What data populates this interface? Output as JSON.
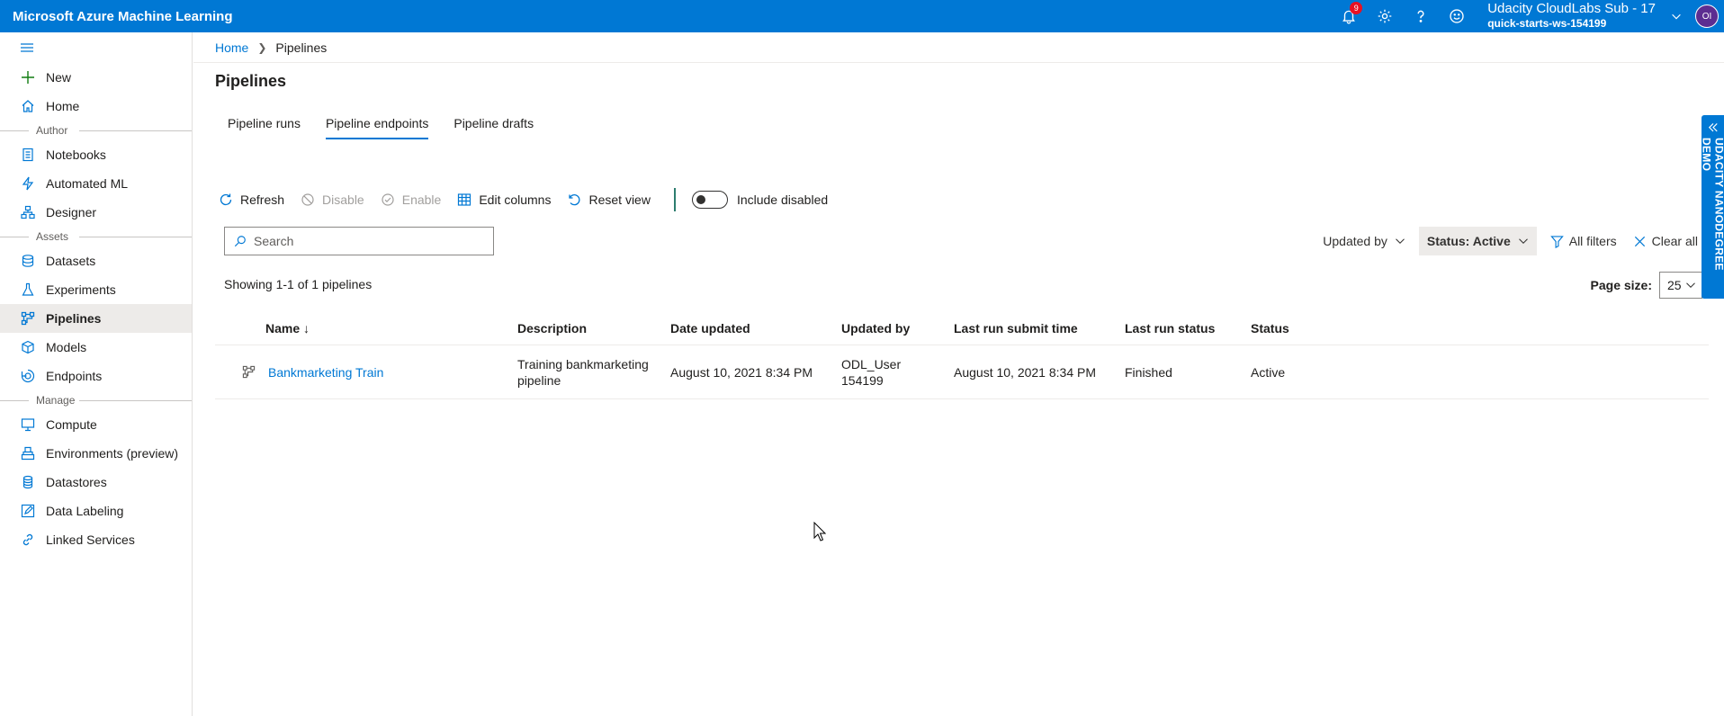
{
  "app": {
    "title": "Microsoft Azure Machine Learning",
    "notifications_count": "9",
    "account_line1": "Udacity CloudLabs Sub - 17",
    "account_line2": "quick-starts-ws-154199",
    "avatar_initials": "OI",
    "brand_color": "#0078d4"
  },
  "sidebar": {
    "new": "New",
    "home": "Home",
    "section_author": "Author",
    "notebooks": "Notebooks",
    "automated_ml": "Automated ML",
    "designer": "Designer",
    "section_assets": "Assets",
    "datasets": "Datasets",
    "experiments": "Experiments",
    "pipelines": "Pipelines",
    "models": "Models",
    "endpoints": "Endpoints",
    "section_manage": "Manage",
    "compute": "Compute",
    "environments": "Environments (preview)",
    "datastores": "Datastores",
    "data_labeling": "Data Labeling",
    "linked_services": "Linked Services"
  },
  "breadcrumb": {
    "home": "Home",
    "current": "Pipelines"
  },
  "page": {
    "title": "Pipelines"
  },
  "tabs": [
    "Pipeline runs",
    "Pipeline endpoints",
    "Pipeline drafts"
  ],
  "toolbar": {
    "refresh": "Refresh",
    "disable": "Disable",
    "enable": "Enable",
    "edit_columns": "Edit columns",
    "reset_view": "Reset view",
    "include_disabled": "Include disabled"
  },
  "search": {
    "placeholder": "Search"
  },
  "filters": {
    "updated_by": "Updated by",
    "status": "Status: Active",
    "all_filters": "All filters",
    "clear_all": "Clear all"
  },
  "list": {
    "showing": "Showing 1-1 of 1 pipelines",
    "page_size_label": "Page size:",
    "page_size_value": "25"
  },
  "table": {
    "headers": {
      "name": "Name ↓",
      "description": "Description",
      "date_updated": "Date updated",
      "updated_by": "Updated by",
      "last_run_submit_time": "Last run submit time",
      "last_run_status": "Last run status",
      "status": "Status"
    },
    "rows": [
      {
        "name": "Bankmarketing Train",
        "description": "Training bankmarketing pipeline",
        "date_updated": "August 10, 2021 8:34 PM",
        "updated_by": "ODL_User 154199",
        "last_run_submit_time": "August 10, 2021 8:34 PM",
        "last_run_status": "Finished",
        "status": "Active"
      }
    ]
  },
  "side_tab": {
    "label": "UDACITY NANODEGREE DEMO"
  }
}
